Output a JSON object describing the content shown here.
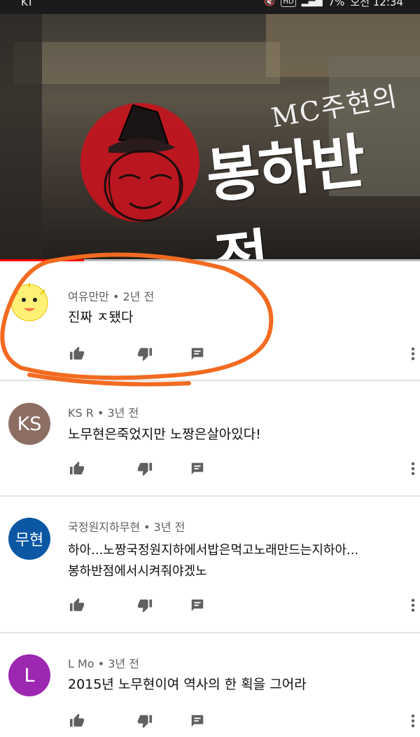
{
  "status_bar": {
    "carrier": "KT",
    "battery": "7%",
    "time": "오전 12:34",
    "hd_label": "HD"
  },
  "video": {
    "overlay_subtitle": "MC주현의",
    "overlay_title": "봉하반점",
    "progress": 0.2
  },
  "comments": [
    {
      "author": "여유만만",
      "age": "2년 전",
      "text": "진짜 ㅈ됐다",
      "avatar_initials": "",
      "avatar_color": "#fff176",
      "highlighted": true
    },
    {
      "author": "KS R",
      "age": "3년 전",
      "text": "노무현은죽었지만 노짱은살아있다!",
      "avatar_initials": "KS",
      "avatar_color": "#8d6e63",
      "highlighted": false
    },
    {
      "author": "국정원지하무현",
      "age": "3년 전",
      "text": "하아...노짱국정원지하에서밥은먹고노래만드는지하아...\n봉하반점에서시켜줘야겠노",
      "avatar_initials": "무현",
      "avatar_color": "#0b57a4",
      "highlighted": false
    },
    {
      "author": "L Mo",
      "age": "3년 전",
      "text": "2015년 노무현이여 역사의 한 획을 그어라",
      "avatar_initials": "L",
      "avatar_color": "#9c27b0",
      "highlighted": false
    }
  ],
  "meta_separator": "•",
  "colors": {
    "annotation": "#f26b21",
    "progress": "#ff0000",
    "icon": "#606060"
  }
}
